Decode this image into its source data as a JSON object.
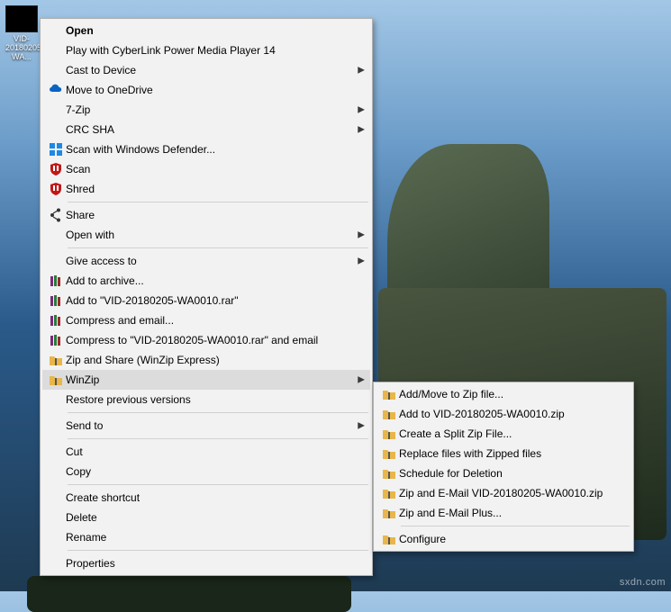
{
  "desktop": {
    "icon_label": "VID-20180205-WA..."
  },
  "watermark": "sxdn.com",
  "menu1": {
    "open": "Open",
    "play": "Play with CyberLink Power Media Player 14",
    "cast": "Cast to Device",
    "onedrive": "Move to OneDrive",
    "sevenzip": "7-Zip",
    "crcsha": "CRC SHA",
    "defender": "Scan with Windows Defender...",
    "scan": "Scan",
    "shred": "Shred",
    "share": "Share",
    "openwith": "Open with",
    "giveaccess": "Give access to",
    "addarchive": "Add to archive...",
    "addtorar": "Add to \"VID-20180205-WA0010.rar\"",
    "compressemail": "Compress and email...",
    "compresstoemail": "Compress to \"VID-20180205-WA0010.rar\" and email",
    "zipshare": "Zip and Share (WinZip Express)",
    "winzip": "WinZip",
    "restore": "Restore previous versions",
    "sendto": "Send to",
    "cut": "Cut",
    "copy": "Copy",
    "createshortcut": "Create shortcut",
    "delete": "Delete",
    "rename": "Rename",
    "properties": "Properties"
  },
  "menu2": {
    "addmove": "Add/Move to Zip file...",
    "addtozip": "Add to VID-20180205-WA0010.zip",
    "split": "Create a Split Zip File...",
    "replace": "Replace files with Zipped files",
    "schedule": "Schedule for Deletion",
    "zipemail": "Zip and E-Mail VID-20180205-WA0010.zip",
    "zipemailplus": "Zip and E-Mail Plus...",
    "configure": "Configure"
  }
}
